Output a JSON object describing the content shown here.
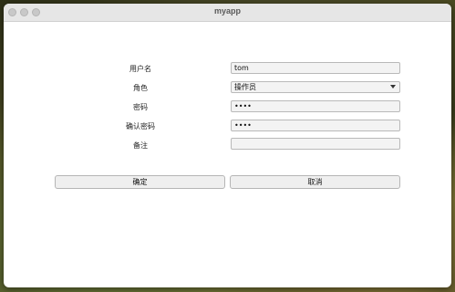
{
  "window": {
    "title": "myapp"
  },
  "form": {
    "username": {
      "label": "用户名",
      "value": "tom"
    },
    "role": {
      "label": "角色",
      "value": "操作员"
    },
    "password": {
      "label": "密码",
      "value": "••••"
    },
    "confirm_password": {
      "label": "确认密码",
      "value": "••••"
    },
    "note": {
      "label": "备注",
      "value": ""
    }
  },
  "buttons": {
    "ok": "确定",
    "cancel": "取消"
  }
}
